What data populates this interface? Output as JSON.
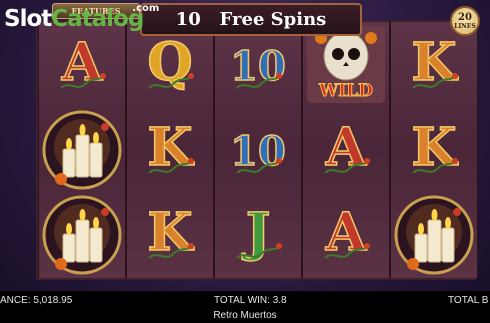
{
  "watermark": {
    "part1": "Slot",
    "part2": "Catalog",
    "suffix": ".com"
  },
  "features_tab": {
    "label": "FEATURES"
  },
  "banner": {
    "count": "10",
    "label": "Free Spins"
  },
  "lines_badge": {
    "number": "20",
    "label": "LINES"
  },
  "reels": [
    [
      "A",
      "candles",
      "candles"
    ],
    [
      "Q",
      "K",
      "K"
    ],
    [
      "10",
      "10",
      "J"
    ],
    [
      "wild",
      "A",
      "A"
    ],
    [
      "K",
      "K",
      "candles"
    ]
  ],
  "wild_label": "WILD",
  "symbol_colors": {
    "A": "#c0392b",
    "K": "#d9822b",
    "Q": "#e0a526",
    "J": "#3f9a3f",
    "10": "#2f6fb8"
  },
  "bottom_bar": {
    "balance": "ANCE: 5,018.95",
    "total_win": "TOTAL WIN: 3.8",
    "total_bet": "TOTAL B",
    "game_title": "Retro Muertos"
  }
}
